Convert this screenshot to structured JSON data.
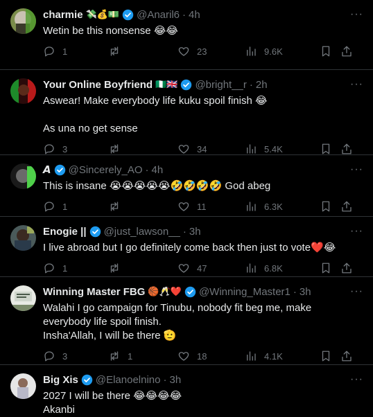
{
  "tweets": [
    {
      "name": "charmie",
      "badges": "💸💰💵",
      "handle": "@Anaril6",
      "time": "4h",
      "text": "Wetin be this nonsense 😂😂",
      "replies": "1",
      "reposts": "",
      "likes": "23",
      "views": "9.6K"
    },
    {
      "name": "Your Online Boyfriend",
      "badges": "🇳🇬🇬🇧",
      "handle": "@bright__r",
      "time": "2h",
      "text": "Aswear! Make everybody life kuku spoil finish 😂\n\nAs una no get sense",
      "replies": "3",
      "reposts": "",
      "likes": "34",
      "views": "5.4K"
    },
    {
      "name": "𝘼",
      "badges": "",
      "handle": "@Sincerely_AO",
      "time": "4h",
      "text": "This is insane 😭😭😭😭😭🤣🤣🤣🤣 God abeg",
      "replies": "1",
      "reposts": "",
      "likes": "11",
      "views": "6.3K"
    },
    {
      "name": "Enogie ||",
      "badges": "",
      "handle": "@just_lawson__",
      "time": "3h",
      "text": "I live abroad but I go definitely come back then just to vote❤️😂",
      "replies": "1",
      "reposts": "",
      "likes": "47",
      "views": "6.8K"
    },
    {
      "name": "Winning Master FBG",
      "badges": "🏀🥂❤️",
      "handle": "@Winning_Master1",
      "time": "3h",
      "text": "Walahi  I go campaign for Tinubu, nobody fit beg me, make everybody life spoil finish.\nInsha'Allah, I will be there 🫡",
      "replies": "3",
      "reposts": "1",
      "likes": "18",
      "views": "4.1K"
    },
    {
      "name": "Big Xis",
      "badges": "",
      "handle": "@Elanoelnino",
      "time": "3h",
      "text": "2027 I will be there 😂😂😂😂\nAkanbi",
      "replies": "",
      "reposts": "",
      "likes": "",
      "views": ""
    }
  ],
  "colors": {
    "background": "#000000",
    "text": "#e7e9ea",
    "muted": "#71767b",
    "verified": "#1d9bf0",
    "divider": "#2f3336"
  },
  "icons": [
    "more-icon",
    "verified-icon",
    "reply-icon",
    "repost-icon",
    "like-icon",
    "views-icon",
    "bookmark-icon",
    "share-icon"
  ]
}
